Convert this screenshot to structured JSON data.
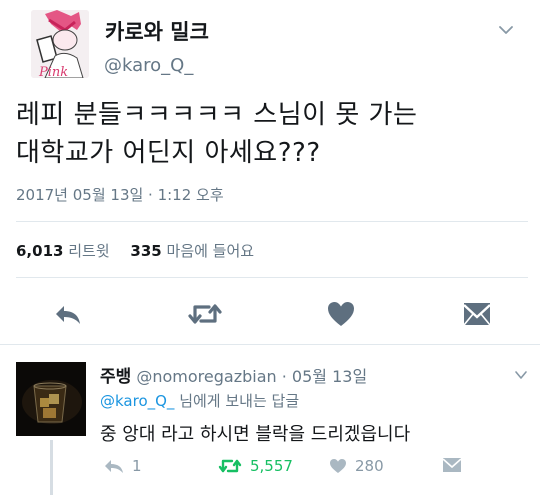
{
  "tweet": {
    "display_name": "카로와 밀크",
    "handle": "@karo_Q_",
    "avatar_text": "Pink",
    "text": "레피 분들ㅋㅋㅋㅋㅋ 스님이 못 가는\n대학교가 어딘지 아세요???",
    "timestamp": "2017년 05월 13일 · 1:12 오후",
    "retweet_count": "6,013",
    "retweet_label": "리트윗",
    "like_count": "335",
    "like_label": "마음에 들어요"
  },
  "actions": [
    "reply-icon",
    "retweet-icon",
    "heart-icon",
    "message-icon"
  ],
  "reply": {
    "display_name": "주뱅",
    "handle": "@nomoregazbian",
    "date": "· 05월 13일",
    "to_mention": "@karo_Q_",
    "to_suffix": " 님에게 보내는 답글",
    "text": "중 앙대 라고 하시면 블락을 드리겠읍니다",
    "reply_count": "1",
    "retweet_count": "5,557",
    "like_count": "280"
  },
  "colors": {
    "text": "#14171a",
    "muted": "#657786",
    "link": "#1b95e0",
    "retweet_green": "#17bf63",
    "icon_dark": "#5e6f7f"
  }
}
